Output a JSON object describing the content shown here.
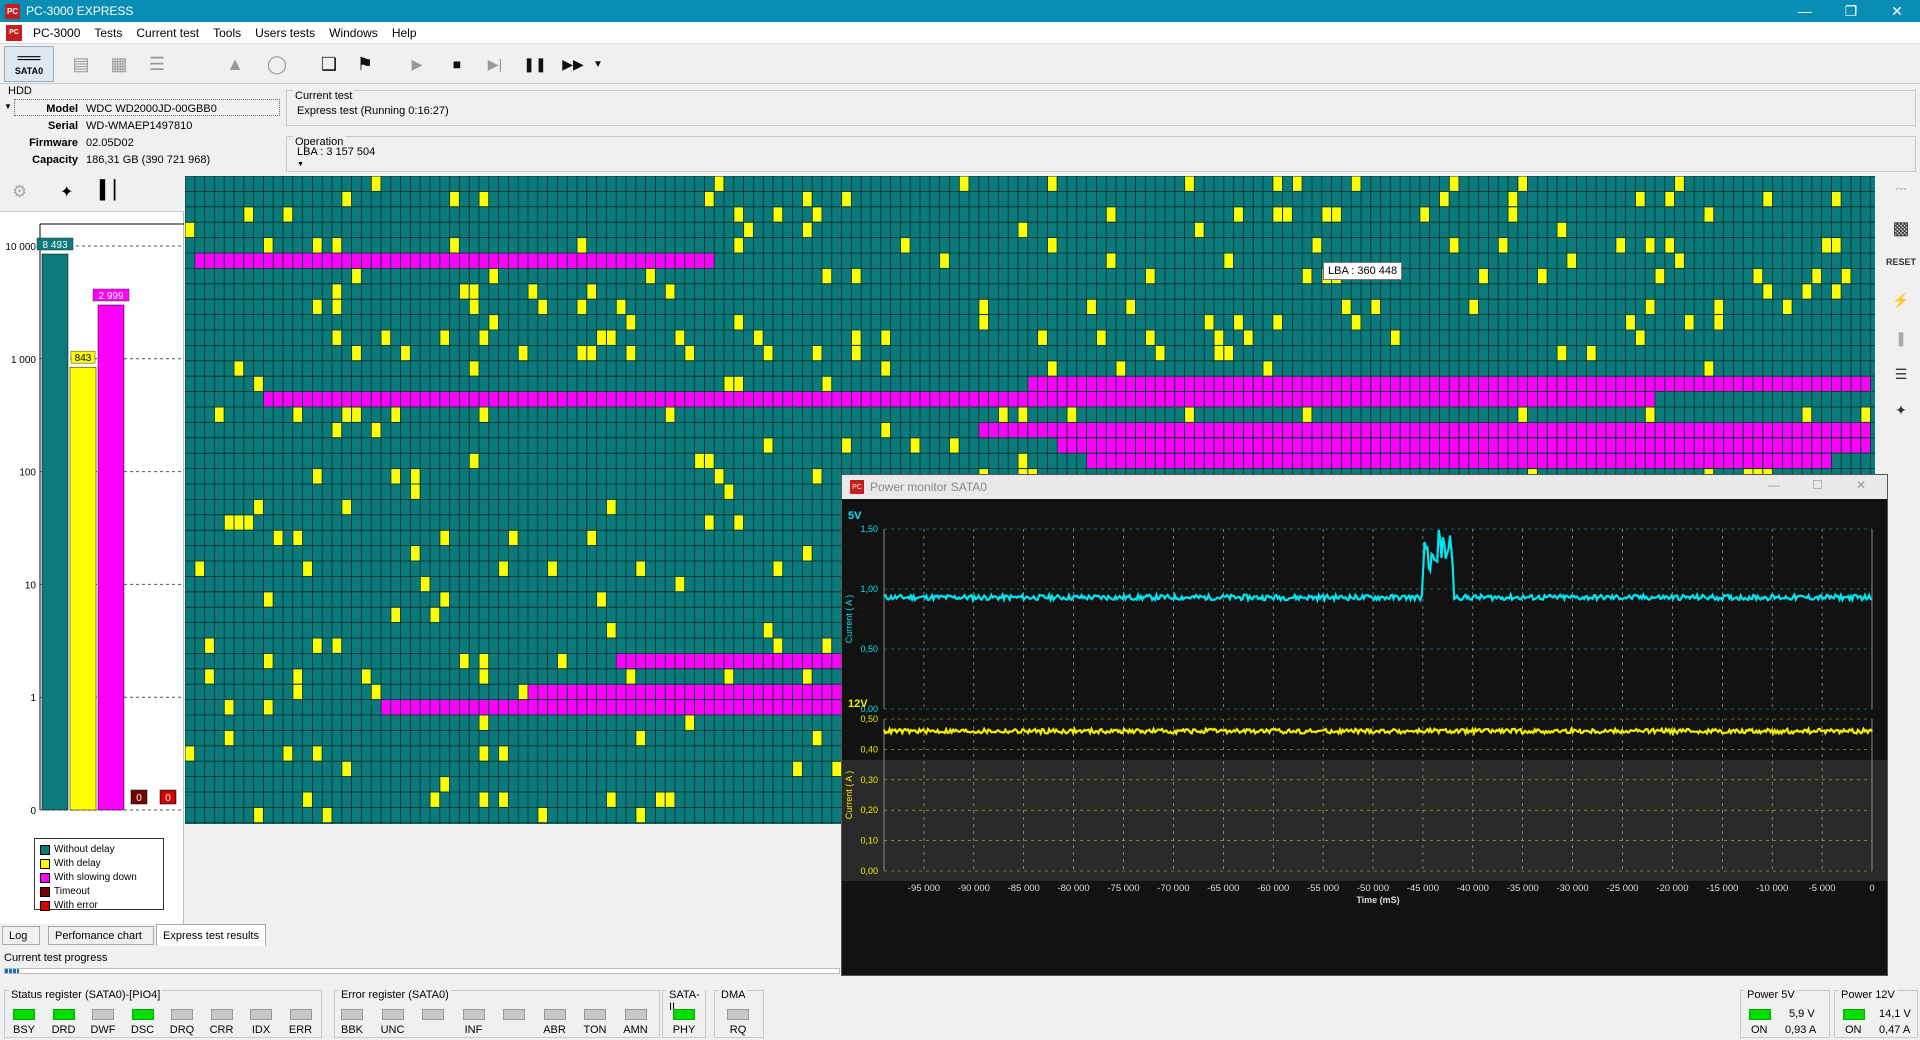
{
  "window": {
    "title": "PC-3000 EXPRESS",
    "minimize_icon": "minimize-icon",
    "restore_icon": "restore-icon",
    "close_icon": "close-icon"
  },
  "menu": [
    "PC-3000",
    "Tests",
    "Current test",
    "Tools",
    "Users tests",
    "Windows",
    "Help"
  ],
  "toolbar": {
    "port_label": "SATA0"
  },
  "hdd": {
    "section_label": "HDD",
    "model_label": "Model",
    "model": "WDC WD2000JD-00GBB0",
    "serial_label": "Serial",
    "serial": "WD-WMAEP1497810",
    "firmware_label": "Firmware",
    "firmware": "02.05D02",
    "capacity_label": "Capacity",
    "capacity": "186,31 GB (390 721 968)"
  },
  "current_test": {
    "label": "Current test",
    "value": "Express test (Running 0:16:27)",
    "operation_label": "Operation",
    "operation_value": "LBA : 3 157 504"
  },
  "perf_chart": {
    "chart_data": {
      "type": "bar",
      "scale": "log",
      "categories": [
        "Without delay",
        "With delay",
        "With slowing down",
        "Timeout",
        "With error"
      ],
      "values": [
        8493,
        843,
        2999,
        0,
        0
      ],
      "value_labels": [
        "8 493",
        "843",
        "2 999",
        "0",
        "0"
      ],
      "colors": [
        "#0b7a7a",
        "#ffff00",
        "#ff00ff",
        "#7a0000",
        "#e00000"
      ],
      "yticks": [
        "10 000",
        "1 000",
        "100",
        "10",
        "1",
        "0"
      ],
      "legend": [
        "Without delay",
        "With delay",
        "With slowing down",
        "Timeout",
        "With error"
      ]
    }
  },
  "grid": {
    "tooltip": "LBA : 360 448",
    "colors": {
      "normal": "#0b7a7a",
      "delay": "#ffff00",
      "slow": "#ff00ff"
    }
  },
  "power_monitor": {
    "title": "Power monitor SATA0",
    "chart_data": [
      {
        "type": "line",
        "channel": "5V",
        "ylabel": "Current ( A )",
        "yticks": [
          "1,50",
          "1,00",
          "0,50",
          "0,00"
        ],
        "ylim": [
          0,
          1.5
        ],
        "baseline": 0.93,
        "spike": {
          "x_from": -45000,
          "x_to": -42000,
          "peak": 1.5
        },
        "color": "#00e6f0"
      },
      {
        "type": "line",
        "channel": "12V",
        "ylabel": "Current ( A )",
        "yticks": [
          "0,50",
          "0,40",
          "0,30",
          "0,20",
          "0,10",
          "0,00"
        ],
        "ylim": [
          0,
          0.5
        ],
        "baseline": 0.46,
        "color": "#f0f000"
      }
    ],
    "xticks": [
      "-95 000",
      "-90 000",
      "-85 000",
      "-80 000",
      "-75 000",
      "-70 000",
      "-65 000",
      "-60 000",
      "-55 000",
      "-50 000",
      "-45 000",
      "-40 000",
      "-35 000",
      "-30 000",
      "-25 000",
      "-20 000",
      "-15 000",
      "-10 000",
      "-5 000",
      "0"
    ],
    "xlabel": "Time (mS)",
    "xlim": [
      -99000,
      0
    ]
  },
  "tabs": [
    "Log",
    "Perfomance chart",
    "Express test results"
  ],
  "progress": {
    "label": "Current test progress"
  },
  "status": {
    "status_reg_label": "Status register (SATA0)-[PIO4]",
    "status_bits": [
      {
        "name": "BSY",
        "on": true
      },
      {
        "name": "DRD",
        "on": true
      },
      {
        "name": "DWF",
        "on": false
      },
      {
        "name": "DSC",
        "on": true
      },
      {
        "name": "DRQ",
        "on": false
      },
      {
        "name": "CRR",
        "on": false
      },
      {
        "name": "IDX",
        "on": false
      },
      {
        "name": "ERR",
        "on": false
      }
    ],
    "error_reg_label": "Error register (SATA0)",
    "error_bits": [
      {
        "name": "BBK",
        "on": false
      },
      {
        "name": "UNC",
        "on": false
      },
      {
        "name": "",
        "on": false
      },
      {
        "name": "INF",
        "on": false
      },
      {
        "name": "",
        "on": false
      },
      {
        "name": "ABR",
        "on": false
      },
      {
        "name": "TON",
        "on": false
      },
      {
        "name": "AMN",
        "on": false
      }
    ],
    "sata_label": "SATA-II",
    "phy_label": "PHY",
    "dma_label": "DMA",
    "rq_label": "RQ",
    "power5_label": "Power 5V",
    "power5_state": "ON",
    "power5_voltage": "5,9 V",
    "power5_current": "0,93 A",
    "power12_label": "Power 12V",
    "power12_state": "ON",
    "power12_voltage": "14,1 V",
    "power12_current": "0,47 A"
  }
}
